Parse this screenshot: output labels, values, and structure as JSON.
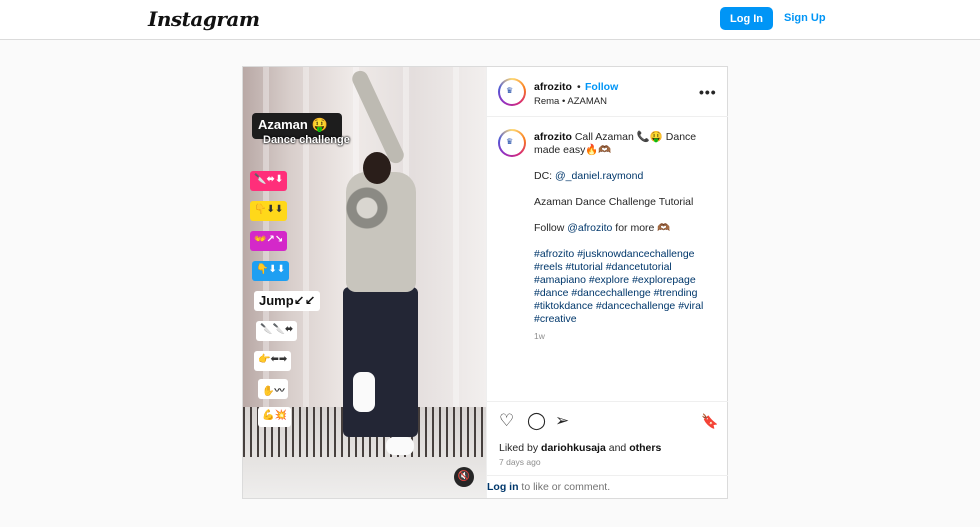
{
  "header": {
    "logo": "Instagram",
    "login_label": "Log In",
    "signup_label": "Sign Up"
  },
  "media": {
    "title_overlay": "Azaman 🤑",
    "subtitle_overlay": "Dance challenge",
    "stickers": [
      "🔪⬌⬇",
      "👇⬇⬇",
      "👐↗↘",
      "👇⬇⬇",
      "Jump↙↙",
      "🔪🔪⬌",
      "👉⬅➡",
      "✋〰",
      "💪💥"
    ],
    "jump_label": "Jump",
    "mute_icon": "🔇"
  },
  "post": {
    "username": "afrozito",
    "separator": "•",
    "follow_label": "Follow",
    "location": "Rema • AZAMAN",
    "more_icon": "•••",
    "caption": {
      "line1_user": "afrozito",
      "line1_text": "Call Azaman 📞🤑 Dance made easy🔥🫶🏾",
      "dc_prefix": "DC:",
      "dc_mention": "@_daniel.raymond",
      "tutorial": "Azaman Dance Challenge Tutorial",
      "follow_prefix": "Follow",
      "follow_mention": "@afrozito",
      "follow_suffix": "for more 🫶🏾",
      "hashtags": "#afrozito #jusknowdancechallenge #reels #tutorial #dancetutorial #amapiano #explore #explorepage #dance #dancechallenge #trending #tiktokdance #dancechallenge #viral #creative",
      "age": "1w"
    },
    "actions": {
      "like_icon": "♡",
      "comment_icon": "◯",
      "share_icon": "➢",
      "save_icon": "🔖"
    },
    "likes_prefix": "Liked by",
    "likes_user": "dariohkusaja",
    "likes_and": "and",
    "likes_others": "others",
    "posted_time": "7 days ago",
    "login_link": "Log in",
    "login_suffix": "to like or comment."
  }
}
